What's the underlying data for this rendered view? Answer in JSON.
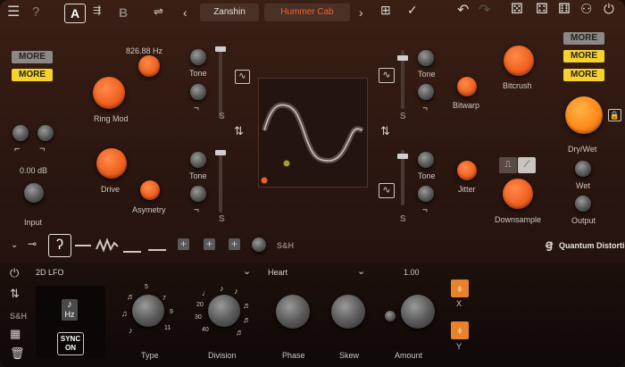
{
  "header": {
    "preset_a": "A",
    "preset_b": "B",
    "prev": "‹",
    "next": "›",
    "bank": "Zanshin",
    "preset": "Hummer Cab"
  },
  "colors": {
    "accent": "#f0611f",
    "more_yellow": "#f7d22b",
    "more_gray": "#8c8884",
    "bg": "#2b1610"
  },
  "left": {
    "more1": "MORE",
    "more2": "MORE",
    "freq": "826.88 Hz",
    "ring_mod": "Ring Mod",
    "gain": "0.00 dB",
    "input": "Input",
    "drive": "Drive",
    "asymetry": "Asymetry"
  },
  "center": {
    "tone1": "Tone",
    "tone2": "Tone",
    "tone3": "Tone",
    "tone4": "Tone",
    "s": "S"
  },
  "right": {
    "more1": "MORE",
    "more2": "MORE",
    "more3": "MORE",
    "bitcrush": "Bitcrush",
    "bitwarp": "Bitwarp",
    "jitter": "Jitter",
    "downsample": "Downsample",
    "dry_wet": "Dry/Wet",
    "wet": "Wet",
    "output": "Output"
  },
  "strip": {
    "sh": "S&H",
    "brand": "Quantum Distortion"
  },
  "lfo": {
    "mode": "2D LFO",
    "shape": "Heart",
    "hz": "Hz",
    "sync": "SYNC",
    "on": "ON",
    "sh": "S&H",
    "type": "Type",
    "division": "Division",
    "phase": "Phase",
    "skew": "Skew",
    "amount": "Amount",
    "amount_value": "1.00",
    "x": "X",
    "y": "Y",
    "type_ticks": [
      "5",
      "7",
      "9",
      "11"
    ],
    "div_ticks": [
      "20",
      "30",
      "40"
    ]
  }
}
